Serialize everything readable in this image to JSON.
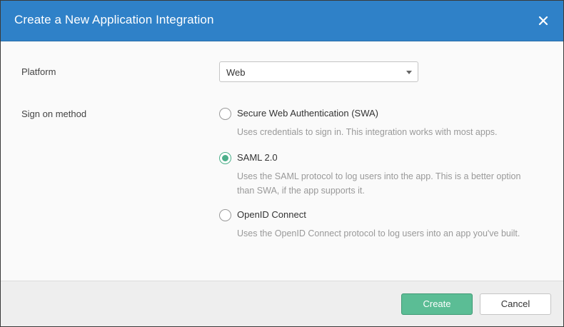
{
  "dialog": {
    "title": "Create a New Application Integration",
    "close_icon": "close-icon"
  },
  "platform": {
    "label": "Platform",
    "selected": "Web"
  },
  "sign_on": {
    "label": "Sign on method",
    "options": [
      {
        "label": "Secure Web Authentication (SWA)",
        "description": "Uses credentials to sign in. This integration works with most apps.",
        "checked": false
      },
      {
        "label": "SAML 2.0",
        "description": "Uses the SAML protocol to log users into the app. This is a better option than SWA, if the app supports it.",
        "checked": true
      },
      {
        "label": "OpenID Connect",
        "description": "Uses the OpenID Connect protocol to log users into an app you've built.",
        "checked": false
      }
    ]
  },
  "footer": {
    "create_label": "Create",
    "cancel_label": "Cancel"
  },
  "colors": {
    "header": "#2f81c8",
    "accent": "#5bbd95"
  }
}
